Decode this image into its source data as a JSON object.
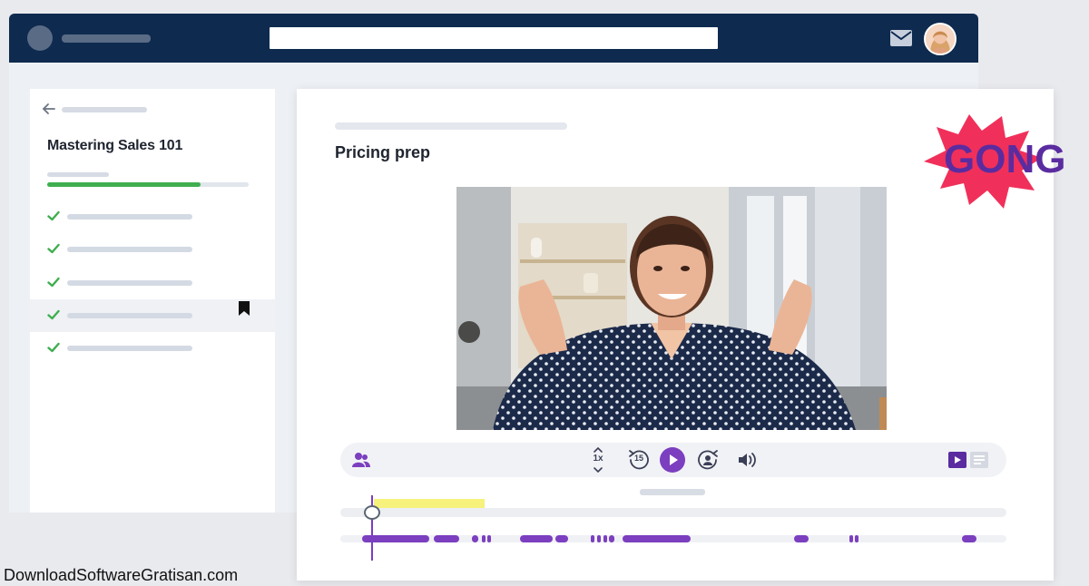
{
  "search": {
    "value": "",
    "placeholder": ""
  },
  "sidebar": {
    "course_title": "Mastering Sales 101",
    "progress": 0.76,
    "lessons": [
      {
        "completed": true,
        "active": false
      },
      {
        "completed": true,
        "active": false
      },
      {
        "completed": true,
        "active": false
      },
      {
        "completed": true,
        "active": true,
        "bookmarked": true
      },
      {
        "completed": true,
        "active": false
      }
    ]
  },
  "main": {
    "title": "Pricing prep"
  },
  "player": {
    "speed_label": "1x",
    "skip_back_label": "15"
  },
  "brand": {
    "badge_text": "GONG"
  },
  "watermark": "DownloadSoftwareGratisan.com",
  "icons": {
    "mail": "mail-icon",
    "back": "arrow-left-icon",
    "check": "check-icon",
    "bookmark": "bookmark-icon",
    "participants": "participants-icon",
    "speed": "speed-icon",
    "rewind": "rewind-15-icon",
    "play": "play-icon",
    "forward": "forward-icon",
    "volume": "volume-icon",
    "video_view": "video-view-icon",
    "transcript_view": "transcript-icon"
  },
  "colors": {
    "topbar": "#0e2a4f",
    "accent": "#7b3fbf",
    "progress": "#3fae4f",
    "highlight": "#f6f27c",
    "badge_burst": "#f0305a",
    "badge_text": "#5a2ca0"
  }
}
